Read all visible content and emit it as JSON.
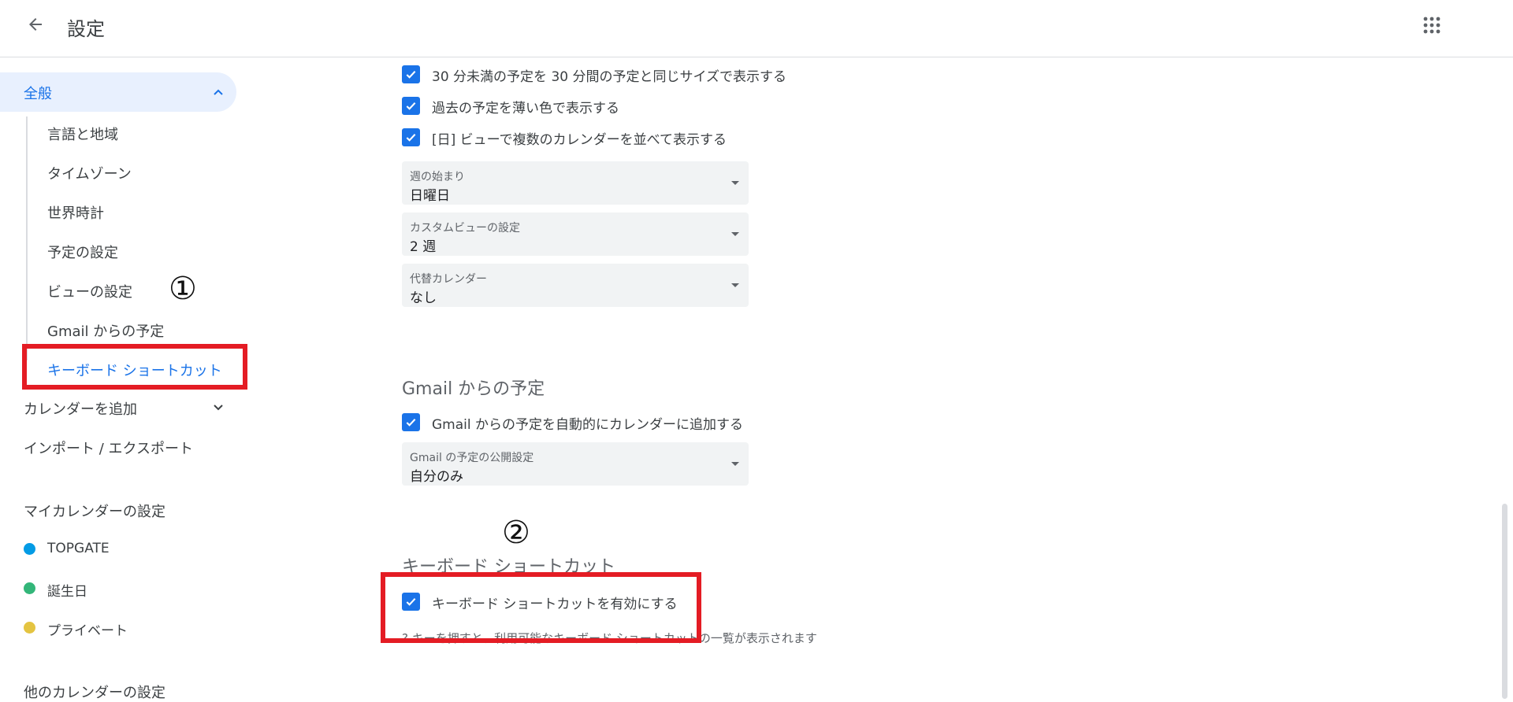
{
  "header": {
    "title": "設定"
  },
  "sidebar": {
    "general": {
      "label": "全般"
    },
    "sub_items": [
      {
        "label": "言語と地域"
      },
      {
        "label": "タイムゾーン"
      },
      {
        "label": "世界時計"
      },
      {
        "label": "予定の設定"
      },
      {
        "label": "ビューの設定"
      },
      {
        "label": "Gmail からの予定"
      },
      {
        "label": "キーボード ショートカット"
      }
    ],
    "add_calendar": {
      "label": "カレンダーを追加"
    },
    "import_export": {
      "label": "インポート / エクスポート"
    },
    "my_calendars": {
      "heading": "マイカレンダーの設定",
      "items": [
        {
          "label": "TOPGATE",
          "color": "#039be5"
        },
        {
          "label": "誕生日",
          "color": "#33b679"
        },
        {
          "label": "プライベート",
          "color": "#e4c441"
        }
      ]
    },
    "other_calendars": {
      "heading": "他のカレンダーの設定"
    }
  },
  "content": {
    "view_checkboxes": [
      {
        "label": "30 分未満の予定を 30 分間の予定と同じサイズで表示する",
        "checked": true
      },
      {
        "label": "過去の予定を薄い色で表示する",
        "checked": true
      },
      {
        "label": "[日] ビューで複数のカレンダーを並べて表示する",
        "checked": true
      }
    ],
    "selects": [
      {
        "label": "週の始まり",
        "value": "日曜日"
      },
      {
        "label": "カスタムビューの設定",
        "value": "2 週"
      },
      {
        "label": "代替カレンダー",
        "value": "なし"
      }
    ],
    "gmail_section": {
      "heading": "Gmail からの予定",
      "checkbox_label": "Gmail からの予定を自動的にカレンダーに追加する",
      "select_label": "Gmail の予定の公開設定",
      "select_value": "自分のみ"
    },
    "keyboard_section": {
      "heading": "キーボード ショートカット",
      "checkbox_label": "キーボード ショートカットを有効にする",
      "hint": "? キーを押すと、利用可能なキーボード ショートカットの一覧が表示されます"
    }
  },
  "annotations": {
    "step1": "①",
    "step2": "②"
  },
  "colors": {
    "accent": "#1a73e8",
    "annotation_red": "#e41c24"
  }
}
